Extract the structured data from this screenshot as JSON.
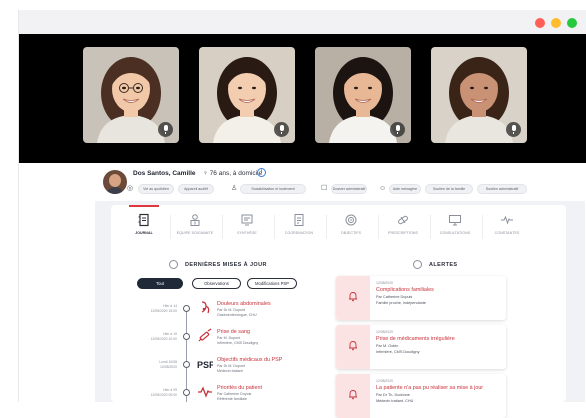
{
  "window": {
    "controls": [
      {
        "name": "close",
        "color": "#ff5f56"
      },
      {
        "name": "minimize",
        "color": "#ffbd2e"
      },
      {
        "name": "maximize",
        "color": "#27c93f"
      }
    ]
  },
  "video": {
    "participants": [
      {
        "name": "participant-1",
        "bg": "#c9c2b8",
        "skin": "#f1c9a8",
        "hair": "#4a2f22",
        "shirt": "#e8e4de"
      },
      {
        "name": "participant-2",
        "bg": "#d7cfc4",
        "skin": "#f2cdb0",
        "hair": "#2a1a14",
        "shirt": "#f3f0ea"
      },
      {
        "name": "participant-3",
        "bg": "#b8b0a4",
        "skin": "#e8b896",
        "hair": "#1c1410",
        "shirt": "#f5f3ef"
      },
      {
        "name": "participant-4",
        "bg": "#d9d2c8",
        "skin": "#c99274",
        "hair": "#3a2418",
        "shirt": "#e9e6e0"
      }
    ]
  },
  "patient": {
    "name": "Dos Santos, Camille",
    "info": "♀ 76 ans, à domicile",
    "info_icon": "i",
    "chips": [
      "Vie au quotidien",
      "Appareil auditif",
      "Sociabilisation et isolement",
      "Dossier administratif",
      "Aide ménagère",
      "Soutien de la famille",
      "Soutien administratif"
    ]
  },
  "nav": {
    "items": [
      {
        "label": "JOURNAL",
        "icon": "journal-icon"
      },
      {
        "label": "ÉQUIPE SOIGNANTE",
        "icon": "care-team-icon"
      },
      {
        "label": "SYNTHÈSE",
        "icon": "summary-icon"
      },
      {
        "label": "COORDINATION",
        "icon": "coordination-icon"
      },
      {
        "label": "OBJECTIFS",
        "icon": "goals-icon"
      },
      {
        "label": "PRESCRIPTIONS",
        "icon": "prescriptions-icon"
      },
      {
        "label": "CONSULTATIONS",
        "icon": "consultations-icon"
      },
      {
        "label": "CONSTANTES",
        "icon": "vitals-icon"
      }
    ]
  },
  "updates": {
    "title": "DERNIÈRES MISES À JOUR",
    "filters": [
      "Tout",
      "Observations",
      "Modifications PSP"
    ],
    "entries": [
      {
        "date": "Hier à 14\n12/08/2020 15:00",
        "title": "Douleurs abdominales",
        "sub1": "Par Dr M. Dupont",
        "sub2": "Gastroentérologue, CHU",
        "icon": "body-icon"
      },
      {
        "date": "Hier à 10\n12/08/2020 10:00",
        "title": "Prise de sang",
        "sub1": "Par M. Dupont",
        "sub2": "Infirmière, CMS Doudigny",
        "icon": "syringe-icon"
      },
      {
        "date": "Lundi 10/08\n10/08/2020",
        "title": "Objectifs médicaux du PSP",
        "sub1": "Par Dr M. Dupont",
        "sub2": "Médecin traitant",
        "icon": "psp-icon"
      },
      {
        "date": "Hier à 09\n12/08/2020 09:00",
        "title": "Priorités du patient",
        "sub1": "Par Catherine Dupuis",
        "sub2": "Référente familiale",
        "icon": "heartbeat-icon"
      }
    ]
  },
  "alerts": {
    "title": "ALERTES",
    "items": [
      {
        "date": "12/08/2020",
        "title": "Complications familiales",
        "sub1": "Par Catherine Dupuis",
        "sub2": "Famille proche, indépendante"
      },
      {
        "date": "12/08/2020",
        "title": "Prise de médicaments irrégulière",
        "sub1": "Par M. Gobin",
        "sub2": "Infirmière, CMS Doudigny"
      },
      {
        "date": "12/08/2020",
        "title": "La patiente n'a pas pu réaliser sa mise à jour",
        "sub1": "Par Dr Th. Dudonne",
        "sub2": "Médecin traitant, CHU"
      }
    ]
  },
  "colors": {
    "accent": "#e0373f",
    "dark": "#1f2937"
  }
}
